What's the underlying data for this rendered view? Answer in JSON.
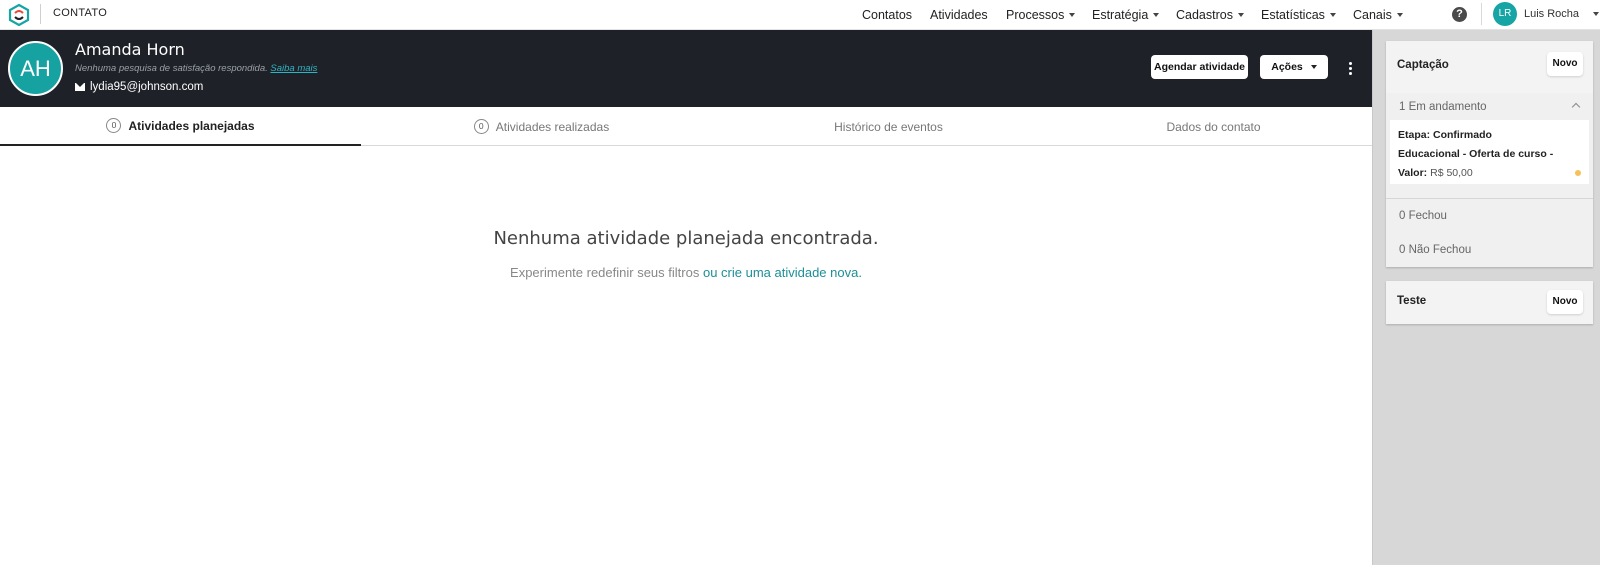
{
  "app": {
    "section_title": "CONTATO"
  },
  "nav": {
    "items": [
      {
        "label": "Contatos",
        "dropdown": false
      },
      {
        "label": "Atividades",
        "dropdown": false
      },
      {
        "label": "Processos",
        "dropdown": true
      },
      {
        "label": "Estratégia",
        "dropdown": true
      },
      {
        "label": "Cadastros",
        "dropdown": true
      },
      {
        "label": "Estatísticas",
        "dropdown": true
      },
      {
        "label": "Canais",
        "dropdown": true
      }
    ],
    "help_icon": "?",
    "user": {
      "initials": "LR",
      "name": "Luis Rocha"
    }
  },
  "contact": {
    "initials": "AH",
    "name": "Amanda Horn",
    "survey_text": "Nenhuma pesquisa de satisfação respondida.",
    "survey_link": "Saiba mais",
    "email": "lydia95@johnson.com",
    "schedule_button": "Agendar atividade",
    "actions_button": "Ações"
  },
  "tabs": [
    {
      "label": "Atividades planejadas",
      "count": "0",
      "active": true
    },
    {
      "label": "Atividades realizadas",
      "count": "0",
      "active": false
    },
    {
      "label": "Histórico de eventos",
      "active": false
    },
    {
      "label": "Dados do contato",
      "active": false
    }
  ],
  "empty_state": {
    "title": "Nenhuma atividade planejada encontrada.",
    "subtitle": "Experimente redefinir seus filtros",
    "link": "ou crie uma atividade nova."
  },
  "sidebar": {
    "captacao": {
      "title": "Captação",
      "new_button": "Novo",
      "in_progress": "1 Em andamento",
      "deal": {
        "stage_label": "Etapa:",
        "stage": "Confirmado",
        "product": "Educacional - Oferta de curso -",
        "value_label": "Valor:",
        "value": "R$ 50,00"
      },
      "closed": "0 Fechou",
      "not_closed": "0 Não Fechou"
    },
    "teste": {
      "title": "Teste",
      "new_button": "Novo"
    }
  },
  "colors": {
    "accent": "#17a2a2",
    "header_bg": "#1e2128",
    "link": "#1c8f97",
    "status_dot": "#f7c15a"
  }
}
